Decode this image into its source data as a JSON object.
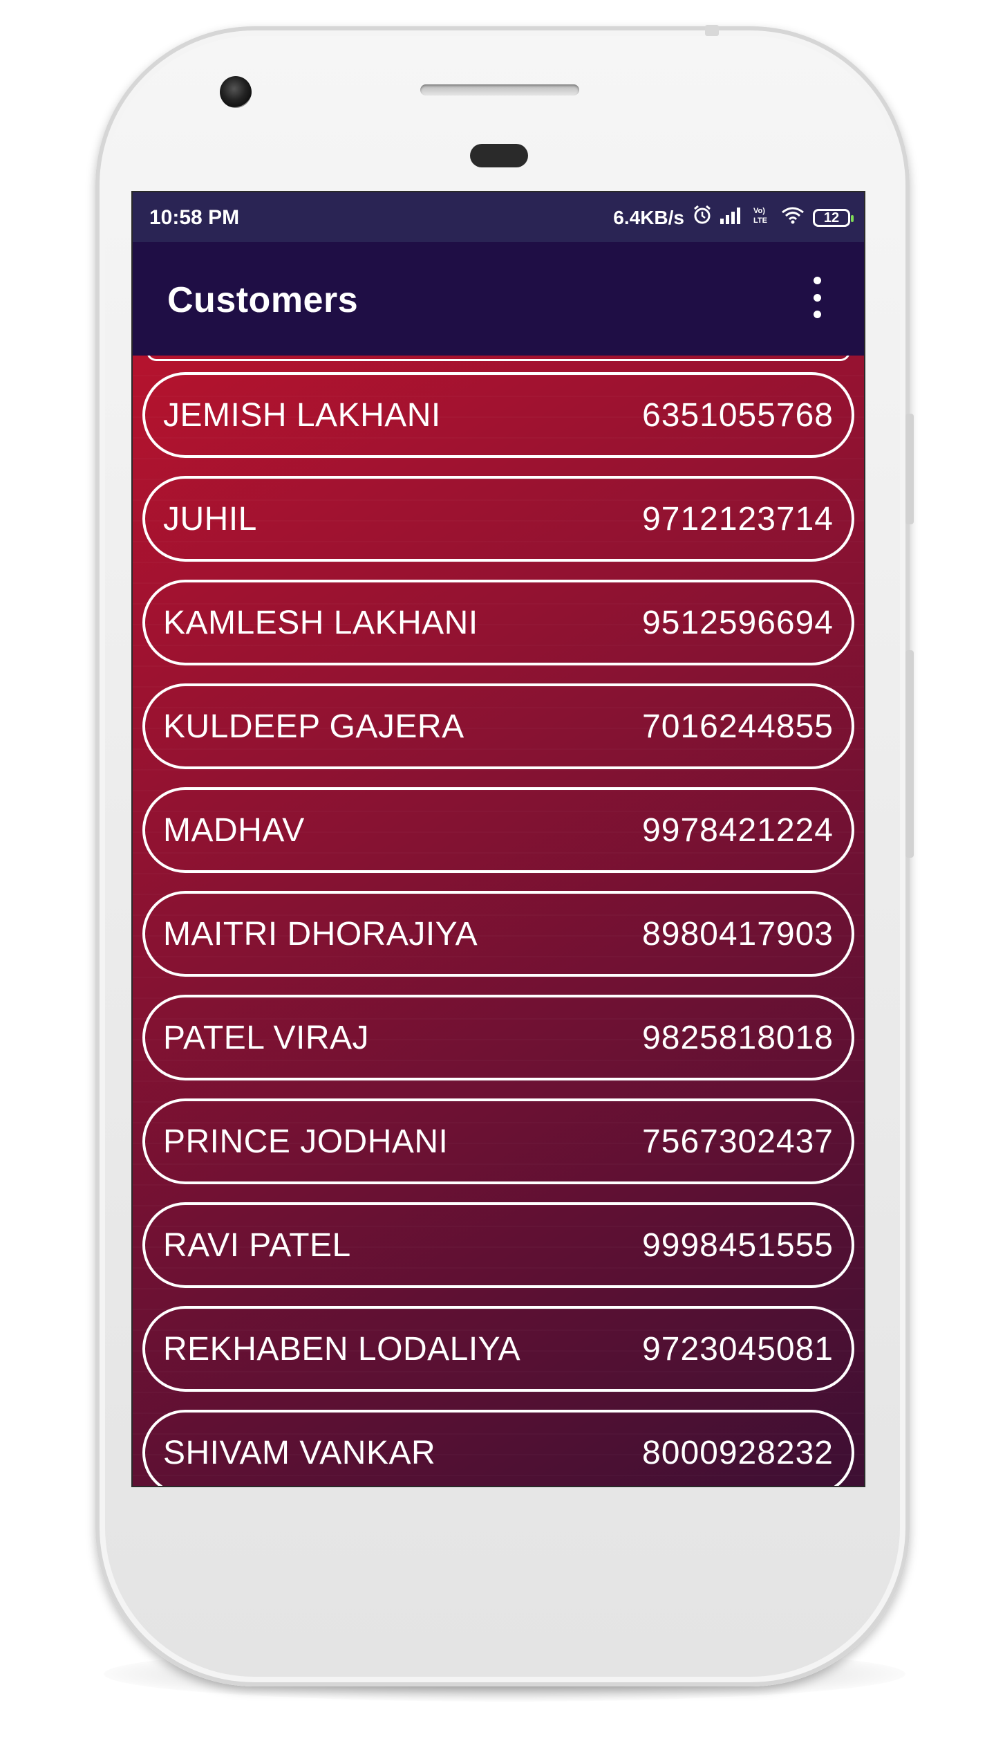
{
  "status_bar": {
    "time": "10:58 PM",
    "network_speed": "6.4KB/s",
    "battery_level": "12",
    "icons": [
      "alarm-icon",
      "signal-icon",
      "volte-icon",
      "wifi-icon",
      "battery-icon"
    ],
    "volte_label": "Vo) LTE"
  },
  "app_bar": {
    "title": "Customers",
    "menu_icon": "overflow-menu-icon"
  },
  "customers": [
    {
      "name": "JEMISH LAKHANI",
      "phone": "6351055768"
    },
    {
      "name": "JUHIL",
      "phone": "9712123714"
    },
    {
      "name": "KAMLESH LAKHANI",
      "phone": "9512596694"
    },
    {
      "name": "KULDEEP GAJERA",
      "phone": "7016244855"
    },
    {
      "name": "MADHAV",
      "phone": "9978421224"
    },
    {
      "name": "MAITRI DHORAJIYA",
      "phone": "8980417903"
    },
    {
      "name": "PATEL VIRAJ",
      "phone": "9825818018"
    },
    {
      "name": "PRINCE JODHANI",
      "phone": "7567302437"
    },
    {
      "name": "RAVI PATEL",
      "phone": "9998451555"
    },
    {
      "name": "REKHABEN LODALIYA",
      "phone": "9723045081"
    },
    {
      "name": "SHIVAM VANKAR",
      "phone": "8000928232"
    }
  ],
  "colors": {
    "status_bar": "#2a2454",
    "app_bar": "#1f0e45",
    "list_gradient_start": "#b5132e",
    "list_gradient_end": "#3d0f33",
    "row_border": "#ffffff",
    "text": "#ffffff"
  }
}
